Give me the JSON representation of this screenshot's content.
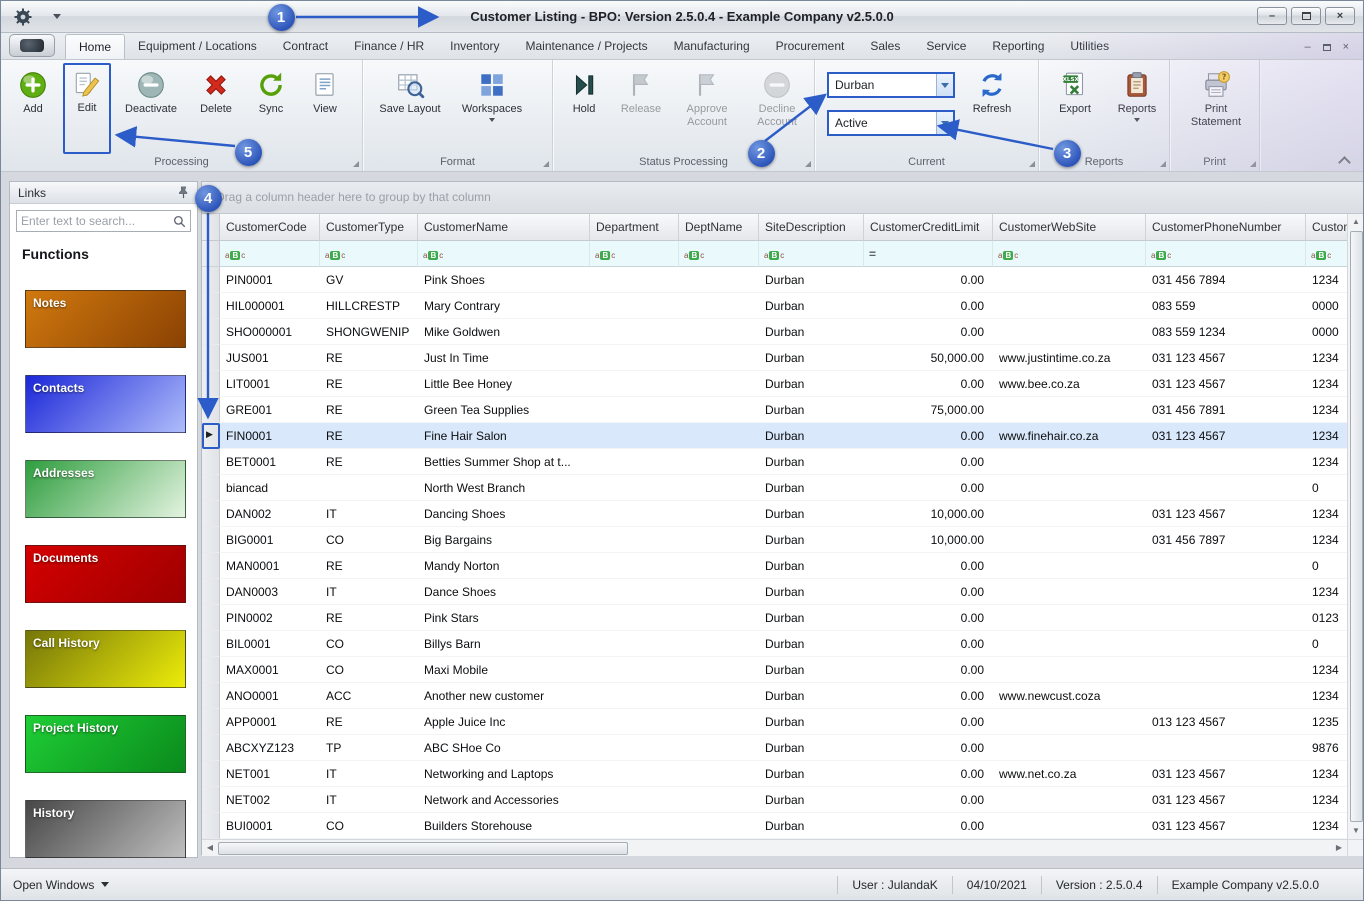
{
  "colors": {
    "annotation_blue": "#2b5cc8",
    "selected_row_blue": "#d9e8fa",
    "filter_row_cyan": "#eafafc"
  },
  "window": {
    "title": "Customer Listing - BPO: Version 2.5.0.4 - Example Company v2.5.0.0"
  },
  "ribbon": {
    "tabs": [
      {
        "label": "Home",
        "active": true
      },
      {
        "label": "Equipment / Locations",
        "active": false
      },
      {
        "label": "Contract",
        "active": false
      },
      {
        "label": "Finance / HR",
        "active": false
      },
      {
        "label": "Inventory",
        "active": false
      },
      {
        "label": "Maintenance / Projects",
        "active": false
      },
      {
        "label": "Manufacturing",
        "active": false
      },
      {
        "label": "Procurement",
        "active": false
      },
      {
        "label": "Sales",
        "active": false
      },
      {
        "label": "Service",
        "active": false
      },
      {
        "label": "Reporting",
        "active": false
      },
      {
        "label": "Utilities",
        "active": false
      }
    ],
    "groups": [
      {
        "label": "Processing",
        "buttons": [
          {
            "label": "Add",
            "icon": "add-icon"
          },
          {
            "label": "Edit",
            "icon": "edit-icon",
            "highlighted": true
          },
          {
            "label": "Deactivate",
            "icon": "deactivate-icon"
          },
          {
            "label": "Delete",
            "icon": "delete-icon"
          },
          {
            "label": "Sync",
            "icon": "sync-icon"
          },
          {
            "label": "View",
            "icon": "view-icon"
          }
        ]
      },
      {
        "label": "Format",
        "buttons": [
          {
            "label": "Save Layout",
            "icon": "save-layout-icon"
          },
          {
            "label": "Workspaces",
            "icon": "workspaces-icon",
            "dropdown": true
          }
        ]
      },
      {
        "label": "Status Processing",
        "buttons": [
          {
            "label": "Hold",
            "icon": "hold-icon"
          },
          {
            "label": "Release",
            "icon": "release-icon",
            "disabled": true
          },
          {
            "label": "Approve Account",
            "icon": "approve-account-icon",
            "disabled": true
          },
          {
            "label": "Decline Account",
            "icon": "decline-account-icon",
            "disabled": true
          }
        ]
      },
      {
        "label": "Current",
        "dropdowns": [
          {
            "name": "site-filter",
            "value": "Durban",
            "highlighted": true
          },
          {
            "name": "status-filter",
            "value": "Active",
            "highlighted": true
          }
        ],
        "buttons": [
          {
            "label": "Refresh",
            "icon": "refresh-icon"
          }
        ]
      },
      {
        "label": "Reports",
        "buttons": [
          {
            "label": "Export",
            "icon": "export-icon"
          },
          {
            "label": "Reports",
            "icon": "reports-icon",
            "dropdown": true
          }
        ]
      },
      {
        "label": "Print",
        "buttons": [
          {
            "label": "Print Statement",
            "icon": "print-statement-icon"
          }
        ]
      }
    ]
  },
  "sidebar": {
    "panel_title": "Links",
    "search_placeholder": "Enter text to search...",
    "section_title": "Functions",
    "items": [
      {
        "label": "Notes",
        "gradient": [
          "#d1790f",
          "#8a4203"
        ]
      },
      {
        "label": "Contacts",
        "gradient": [
          "#1c27d8",
          "#aebcfa"
        ]
      },
      {
        "label": "Addresses",
        "gradient": [
          "#2f9e3f",
          "#e4f3e0"
        ]
      },
      {
        "label": "Documents",
        "gradient": [
          "#d40000",
          "#9e0000"
        ]
      },
      {
        "label": "Call History",
        "gradient": [
          "#76760a",
          "#ecec0a"
        ]
      },
      {
        "label": "Project History",
        "gradient": [
          "#1fce35",
          "#0a8a1c"
        ]
      },
      {
        "label": "History",
        "gradient": [
          "#474747",
          "#bfbfbf"
        ]
      }
    ]
  },
  "grid": {
    "group_by_text": "Drag a column header here to group by that column",
    "columns": [
      "CustomerCode",
      "CustomerType",
      "CustomerName",
      "Department",
      "DeptName",
      "SiteDescription",
      "CustomerCreditLimit",
      "CustomerWebSite",
      "CustomerPhoneNumber",
      "Custome"
    ],
    "filter_icons": [
      "abc",
      "abc",
      "abc",
      "abc",
      "abc",
      "abc",
      "eq",
      "abc",
      "abc",
      "abc"
    ],
    "selected_row": 6,
    "rows": [
      [
        "PIN0001",
        "GV",
        "Pink Shoes",
        "",
        "",
        "Durban",
        "0.00",
        "",
        "031 456 7894",
        "1234"
      ],
      [
        "HIL000001",
        "HILLCRESTP",
        "Mary Contrary",
        "",
        "",
        "Durban",
        "0.00",
        "",
        "083 559",
        "0000"
      ],
      [
        "SHO000001",
        "SHONGWENIP",
        "Mike Goldwen",
        "",
        "",
        "Durban",
        "0.00",
        "",
        "083 559 1234",
        "0000"
      ],
      [
        "JUS001",
        "RE",
        "Just In Time",
        "",
        "",
        "Durban",
        "50,000.00",
        "www.justintime.co.za",
        "031 123 4567",
        "1234"
      ],
      [
        "LIT0001",
        "RE",
        "Little Bee Honey",
        "",
        "",
        "Durban",
        "0.00",
        "www.bee.co.za",
        "031 123 4567",
        "1234"
      ],
      [
        "GRE001",
        "RE",
        "Green Tea Supplies",
        "",
        "",
        "Durban",
        "75,000.00",
        "",
        "031 456 7891",
        "1234"
      ],
      [
        "FIN0001",
        "RE",
        "Fine Hair Salon",
        "",
        "",
        "Durban",
        "0.00",
        "www.finehair.co.za",
        "031 123 4567",
        "1234"
      ],
      [
        "BET0001",
        "RE",
        "Betties Summer Shop at t...",
        "",
        "",
        "Durban",
        "0.00",
        "",
        "",
        "1234"
      ],
      [
        "biancad",
        "",
        "North West Branch",
        "",
        "",
        "Durban",
        "0.00",
        "",
        "",
        "0"
      ],
      [
        "DAN002",
        "IT",
        "Dancing Shoes",
        "",
        "",
        "Durban",
        "10,000.00",
        "",
        "031 123 4567",
        "1234"
      ],
      [
        "BIG0001",
        "CO",
        "Big Bargains",
        "",
        "",
        "Durban",
        "10,000.00",
        "",
        "031 456 7897",
        "1234"
      ],
      [
        "MAN0001",
        "RE",
        "Mandy Norton",
        "",
        "",
        "Durban",
        "0.00",
        "",
        "",
        "0"
      ],
      [
        "DAN0003",
        "IT",
        "Dance Shoes",
        "",
        "",
        "Durban",
        "0.00",
        "",
        "",
        "1234"
      ],
      [
        "PIN0002",
        "RE",
        "Pink Stars",
        "",
        "",
        "Durban",
        "0.00",
        "",
        "",
        "0123"
      ],
      [
        "BIL0001",
        "CO",
        "Billys Barn",
        "",
        "",
        "Durban",
        "0.00",
        "",
        "",
        "0"
      ],
      [
        "MAX0001",
        "CO",
        "Maxi Mobile",
        "",
        "",
        "Durban",
        "0.00",
        "",
        "",
        "1234"
      ],
      [
        "ANO0001",
        "ACC",
        "Another new customer",
        "",
        "",
        "Durban",
        "0.00",
        "www.newcust.coza",
        "",
        "1234"
      ],
      [
        "APP0001",
        "RE",
        "Apple Juice Inc",
        "",
        "",
        "Durban",
        "0.00",
        "",
        "013 123 4567",
        "1235"
      ],
      [
        "ABCXYZ123",
        "TP",
        "ABC SHoe Co",
        "",
        "",
        "Durban",
        "0.00",
        "",
        "",
        "9876"
      ],
      [
        "NET001",
        "IT",
        "Networking and Laptops",
        "",
        "",
        "Durban",
        "0.00",
        "www.net.co.za",
        "031 123 4567",
        "1234"
      ],
      [
        "NET002",
        "IT",
        "Network and Accessories",
        "",
        "",
        "Durban",
        "0.00",
        "",
        "031 123 4567",
        "1234"
      ],
      [
        "BUI0001",
        "CO",
        "Builders Storehouse",
        "",
        "",
        "Durban",
        "0.00",
        "",
        "031 123 4567",
        "1234"
      ]
    ]
  },
  "statusbar": {
    "open_windows_label": "Open Windows",
    "segments": [
      "User : JulandaK",
      "04/10/2021",
      "Version : 2.5.0.4",
      "Example Company v2.5.0.0"
    ]
  },
  "annotations": [
    {
      "number": "1"
    },
    {
      "number": "2"
    },
    {
      "number": "3"
    },
    {
      "number": "4"
    },
    {
      "number": "5"
    }
  ]
}
